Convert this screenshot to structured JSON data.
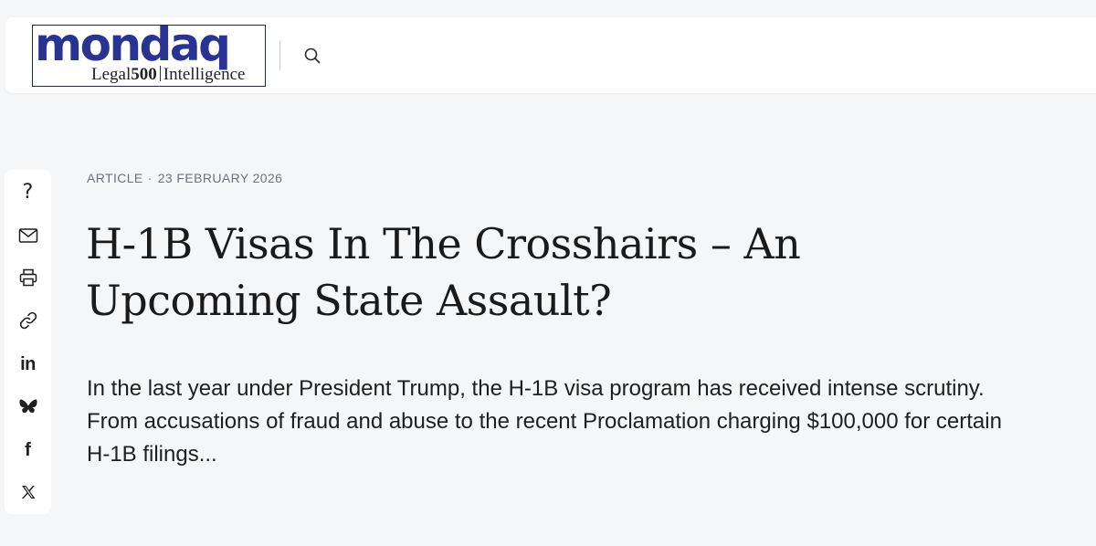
{
  "header": {
    "logo": {
      "wordmark": "mondaq",
      "sub_left": "Legal",
      "sub_strong": "500",
      "sub_right": "Intelligence"
    },
    "search_icon": "search-icon"
  },
  "share_bar": {
    "items": [
      {
        "name": "help",
        "icon": "question-icon",
        "glyph": "?"
      },
      {
        "name": "email",
        "icon": "mail-icon"
      },
      {
        "name": "print",
        "icon": "printer-icon"
      },
      {
        "name": "copy-link",
        "icon": "link-icon"
      },
      {
        "name": "linkedin",
        "icon": "linkedin-icon",
        "glyph": "in"
      },
      {
        "name": "bluesky",
        "icon": "bluesky-icon"
      },
      {
        "name": "facebook",
        "icon": "facebook-icon",
        "glyph": "f"
      },
      {
        "name": "x",
        "icon": "x-icon"
      }
    ]
  },
  "article": {
    "type": "ARTICLE",
    "separator": "·",
    "date": "23 FEBRUARY 2026",
    "title": "H-1B Visas In The Crosshairs – An Upcoming State Assault?",
    "summary": "In the last year under President Trump, the H-1B visa program has received intense scrutiny. From accusations of fraud and abuse to the recent Proclamation charging $100,000 for certain H-1B filings..."
  },
  "colors": {
    "page_background": "#f5f6f8",
    "brand_blue": "#2a3490",
    "meta_text": "#6b7280",
    "title_text": "#1a1a1a"
  }
}
